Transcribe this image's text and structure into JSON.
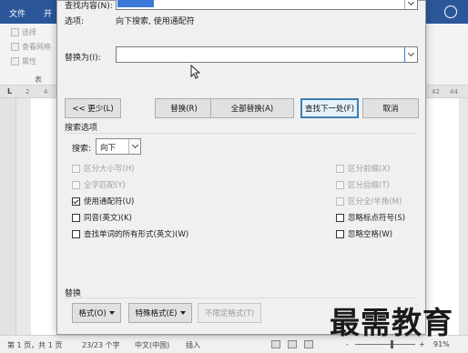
{
  "ribbon": {
    "tabs": [
      "文件",
      "开"
    ],
    "items": [
      "选择",
      "查看网格",
      "属性"
    ],
    "group_label": "表"
  },
  "ruler": {
    "unit_marker": "L",
    "numbers": [
      "2",
      "4",
      "42",
      "44"
    ]
  },
  "dialog": {
    "find_label": "查找内容(N):",
    "find_value": "",
    "options_label": "选项:",
    "options_value": "向下搜索, 使用通配符",
    "replace_label": "替换为(I):",
    "replace_value": "",
    "buttons": {
      "less": "<< 更少(L)",
      "replace": "替换(R)",
      "replace_all": "全部替换(A)",
      "find_next": "查找下一处(F)",
      "cancel": "取消"
    },
    "search_options": {
      "title": "搜索选项",
      "search_label": "搜索:",
      "search_value": "向下",
      "left": [
        {
          "label": "区分大小写(H)",
          "checked": false,
          "disabled": true
        },
        {
          "label": "全字匹配(Y)",
          "checked": false,
          "disabled": true
        },
        {
          "label": "使用通配符(U)",
          "checked": true,
          "disabled": false
        },
        {
          "label": "同音(英文)(K)",
          "checked": false,
          "disabled": false
        },
        {
          "label": "查找单词的所有形式(英文)(W)",
          "checked": false,
          "disabled": false
        }
      ],
      "right": [
        {
          "label": "区分前缀(X)",
          "checked": false,
          "disabled": true
        },
        {
          "label": "区分后缀(T)",
          "checked": false,
          "disabled": true
        },
        {
          "label": "区分全/半角(M)",
          "checked": false,
          "disabled": true
        },
        {
          "label": "忽略标点符号(S)",
          "checked": false,
          "disabled": false
        },
        {
          "label": "忽略空格(W)",
          "checked": false,
          "disabled": false
        }
      ]
    },
    "replace_section": {
      "title": "替换",
      "format_btn": "格式(O)",
      "special_btn": "特殊格式(E)",
      "no_format_btn": "不限定格式(T)"
    }
  },
  "statusbar": {
    "page": "第 1 页，共 1 页",
    "words": "23/23 个字",
    "language": "中文(中国)",
    "insert": "插入",
    "zoom_minus": "-",
    "zoom_plus": "+",
    "zoom": "91%",
    "zoom_fraction": 0.6
  },
  "watermark": "最需教育",
  "colors": {
    "ribbon_blue": "#2b579a",
    "default_button_border": "#3c7fb1",
    "selection_blue": "#3b78d7"
  }
}
